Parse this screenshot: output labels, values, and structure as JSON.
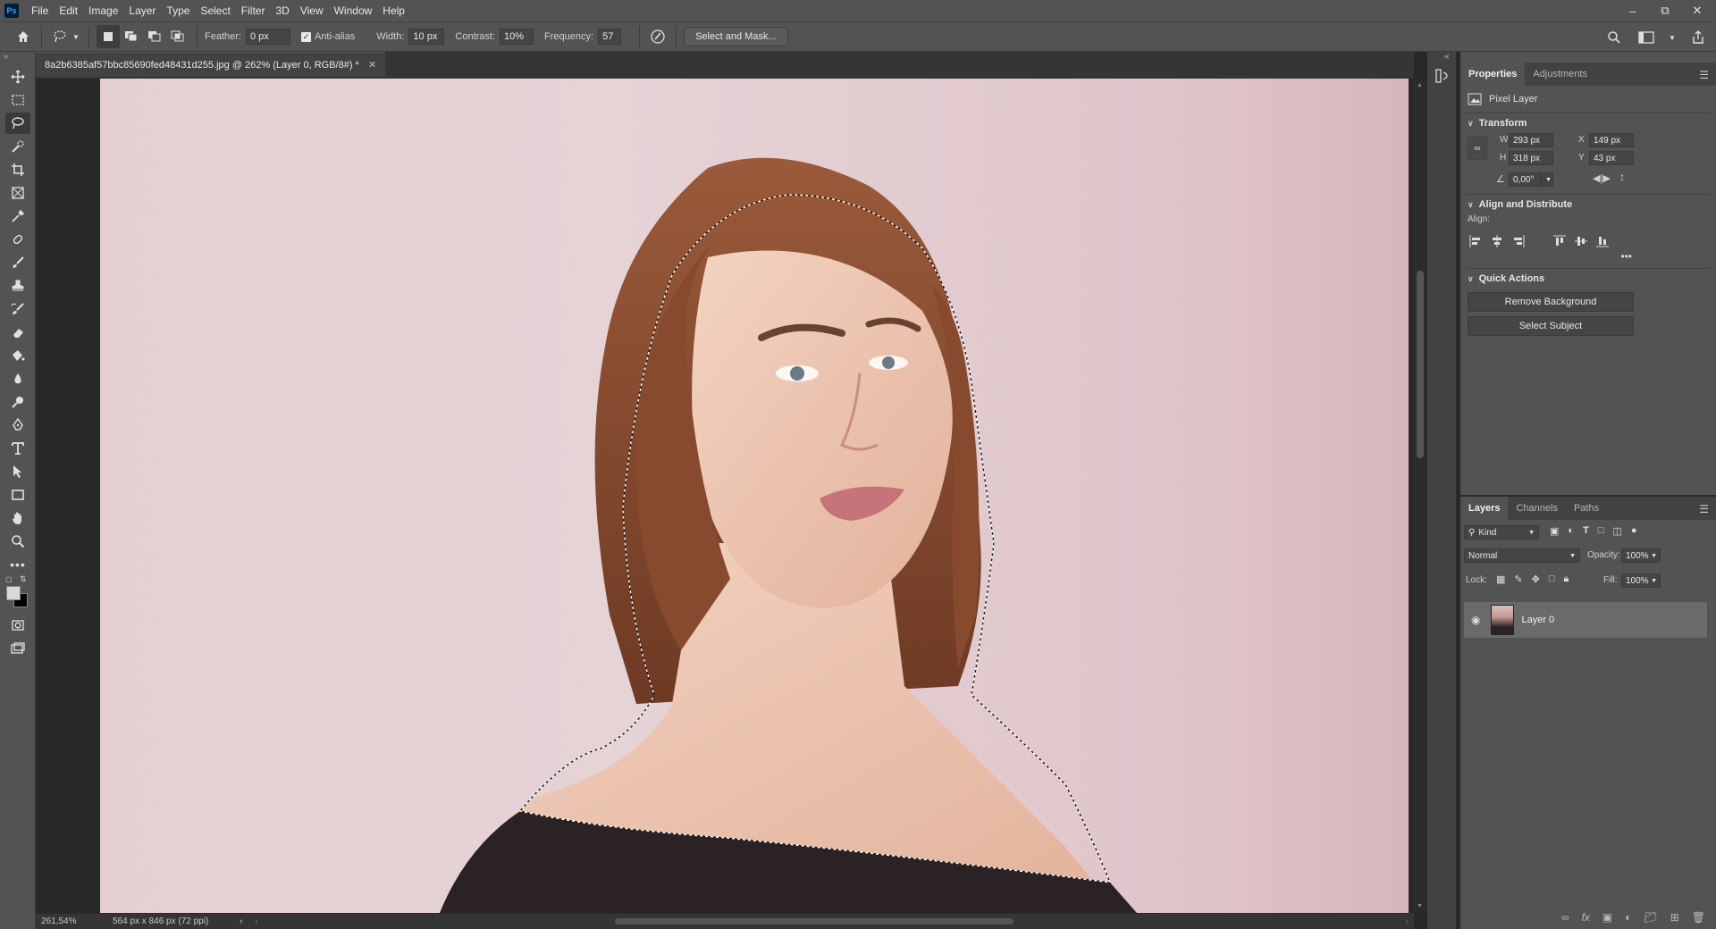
{
  "app": {
    "logo": "Ps"
  },
  "menu": [
    "File",
    "Edit",
    "Image",
    "Layer",
    "Type",
    "Select",
    "Filter",
    "3D",
    "View",
    "Window",
    "Help"
  ],
  "options": {
    "feather_label": "Feather:",
    "feather_value": "0 px",
    "antialias_label": "Anti-alias",
    "width_label": "Width:",
    "width_value": "10 px",
    "contrast_label": "Contrast:",
    "contrast_value": "10%",
    "frequency_label": "Frequency:",
    "frequency_value": "57",
    "select_mask_label": "Select and Mask..."
  },
  "document": {
    "tab_title": "8a2b6385af57bbc85690fed48431d255.jpg @ 262% (Layer 0, RGB/8#) *",
    "zoom": "261,54%",
    "doc_info": "564 px x 846 px (72 ppi)"
  },
  "properties": {
    "tab_properties": "Properties",
    "tab_adjustments": "Adjustments",
    "kind": "Pixel Layer",
    "transform_title": "Transform",
    "w_label": "W",
    "w_value": "293 px",
    "h_label": "H",
    "h_value": "318 px",
    "x_label": "X",
    "x_value": "149 px",
    "y_label": "Y",
    "y_value": "43 px",
    "angle_value": "0,00°",
    "align_title": "Align and Distribute",
    "align_label": "Align:",
    "quick_title": "Quick Actions",
    "remove_bg": "Remove Background",
    "select_subject": "Select Subject"
  },
  "layers": {
    "tab_layers": "Layers",
    "tab_channels": "Channels",
    "tab_paths": "Paths",
    "filter_kind": "Kind",
    "blend_mode": "Normal",
    "opacity_label": "Opacity:",
    "opacity_value": "100%",
    "lock_label": "Lock:",
    "fill_label": "Fill:",
    "fill_value": "100%",
    "layer_name": "Layer 0"
  },
  "colors": {
    "foreground": "#d9d9d9",
    "background": "#000000"
  }
}
